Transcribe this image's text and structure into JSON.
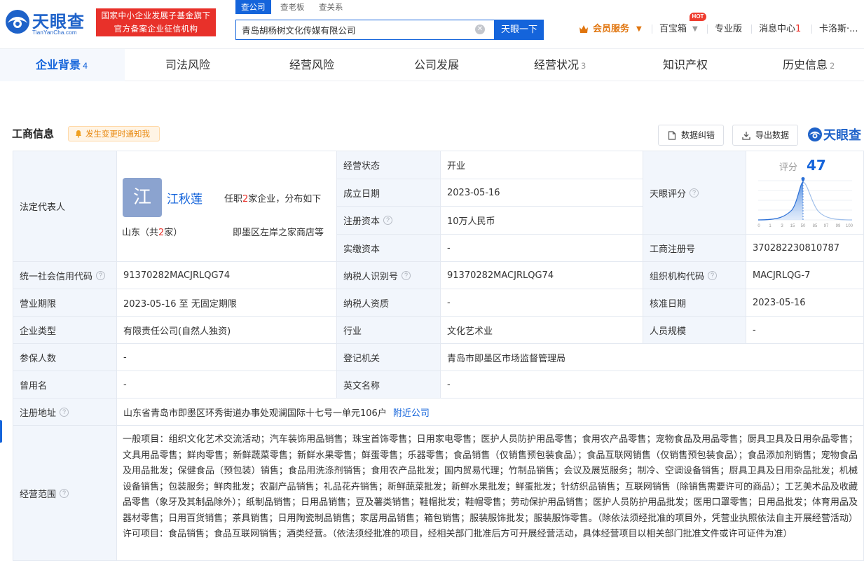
{
  "header": {
    "logo_text": "天眼查",
    "logo_sub": "TianYanCha.com",
    "gov_badge_line1": "国家中小企业发展子基金旗下",
    "gov_badge_line2": "官方备案企业征信机构",
    "search_tabs": [
      "查公司",
      "查老板",
      "查关系"
    ],
    "search_value": "青岛胡杨树文化传媒有限公司",
    "search_button": "天眼一下",
    "nav": {
      "vip": "会员服务",
      "toolbox": "百宝箱",
      "hot": "HOT",
      "pro": "专业版",
      "messages": "消息中心",
      "messages_count": "1",
      "user": "卡洛斯·..."
    }
  },
  "category_tabs": [
    {
      "label": "企业背景",
      "count": "4"
    },
    {
      "label": "司法风险",
      "count": ""
    },
    {
      "label": "经营风险",
      "count": ""
    },
    {
      "label": "公司发展",
      "count": ""
    },
    {
      "label": "经营状况",
      "count": "3"
    },
    {
      "label": "知识产权",
      "count": ""
    },
    {
      "label": "历史信息",
      "count": "2"
    }
  ],
  "section": {
    "title": "工商信息",
    "notify": "发生变更时通知我",
    "correct_btn": "数据纠错",
    "export_btn": "导出数据",
    "brand": "天眼查"
  },
  "legal_rep": {
    "label": "法定代表人",
    "avatar_char": "江",
    "name": "江秋莲",
    "info_prefix": "任职",
    "info_count": "2",
    "info_suffix": "家企业，分布如下",
    "region_prefix": "山东（共",
    "region_count": "2",
    "region_suffix": "家）",
    "store": "即墨区左岸之家商店等"
  },
  "score": {
    "label": "评分",
    "value": "47",
    "axis": [
      "0",
      "1",
      "3",
      "15",
      "50",
      "85",
      "97",
      "99",
      "100"
    ]
  },
  "fields": {
    "status_label": "经营状态",
    "status": "开业",
    "founded_label": "成立日期",
    "founded": "2023-05-16",
    "tyscore_label": "天眼评分",
    "capital_label": "注册资本",
    "capital": "10万人民币",
    "paid_label": "实缴资本",
    "paid": "-",
    "regno_label": "工商注册号",
    "regno": "370282230810787",
    "credit_label": "统一社会信用代码",
    "credit": "91370282MACJRLQG74",
    "taxid_label": "纳税人识别号",
    "taxid": "91370282MACJRLQG74",
    "orgcode_label": "组织机构代码",
    "orgcode": "MACJRLQG-7",
    "term_label": "营业期限",
    "term": "2023-05-16 至 无固定期限",
    "taxq_label": "纳税人资质",
    "taxq": "-",
    "approve_label": "核准日期",
    "approve": "2023-05-16",
    "type_label": "企业类型",
    "type": "有限责任公司(自然人独资)",
    "industry_label": "行业",
    "industry": "文化艺术业",
    "staff_label": "人员规模",
    "staff": "-",
    "insured_label": "参保人数",
    "insured": "-",
    "authority_label": "登记机关",
    "authority": "青岛市即墨区市场监督管理局",
    "formername_label": "曾用名",
    "formername": "-",
    "english_label": "英文名称",
    "english": "-",
    "address_label": "注册地址",
    "address": "山东省青岛市即墨区环秀街道办事处观澜国际十七号一单元106户",
    "nearby": "附近公司",
    "scope_label": "经营范围",
    "scope": "一般项目：组织文化艺术交流活动；汽车装饰用品销售；珠宝首饰零售；日用家电零售；医护人员防护用品零售；食用农产品零售；宠物食品及用品零售；厨具卫具及日用杂品零售；文具用品零售；鲜肉零售；新鲜蔬菜零售；新鲜水果零售；鲜蛋零售；乐器零售；食品销售（仅销售预包装食品）；食品互联网销售（仅销售预包装食品）；食品添加剂销售；宠物食品及用品批发；保健食品（预包装）销售；食品用洗涤剂销售；食用农产品批发；国内贸易代理；竹制品销售；会议及展览服务；制冷、空调设备销售；厨具卫具及日用杂品批发；机械设备销售；包装服务；鲜肉批发；农副产品销售；礼品花卉销售；新鲜蔬菜批发；新鲜水果批发；鲜蛋批发；针纺织品销售；互联网销售（除销售需要许可的商品）；工艺美术品及收藏品零售（象牙及其制品除外）；纸制品销售；日用品销售；豆及薯类销售；鞋帽批发；鞋帽零售；劳动保护用品销售；医护人员防护用品批发；医用口罩零售；日用品批发；体育用品及器材零售；日用百货销售；茶具销售；日用陶瓷制品销售；家居用品销售；箱包销售；服装服饰批发；服装服饰零售。（除依法须经批准的项目外，凭营业执照依法自主开展经营活动）许可项目：食品销售；食品互联网销售；酒类经营。（依法须经批准的项目，经相关部门批准后方可开展经营活动，具体经营项目以相关部门批准文件或许可证件为准）"
  }
}
